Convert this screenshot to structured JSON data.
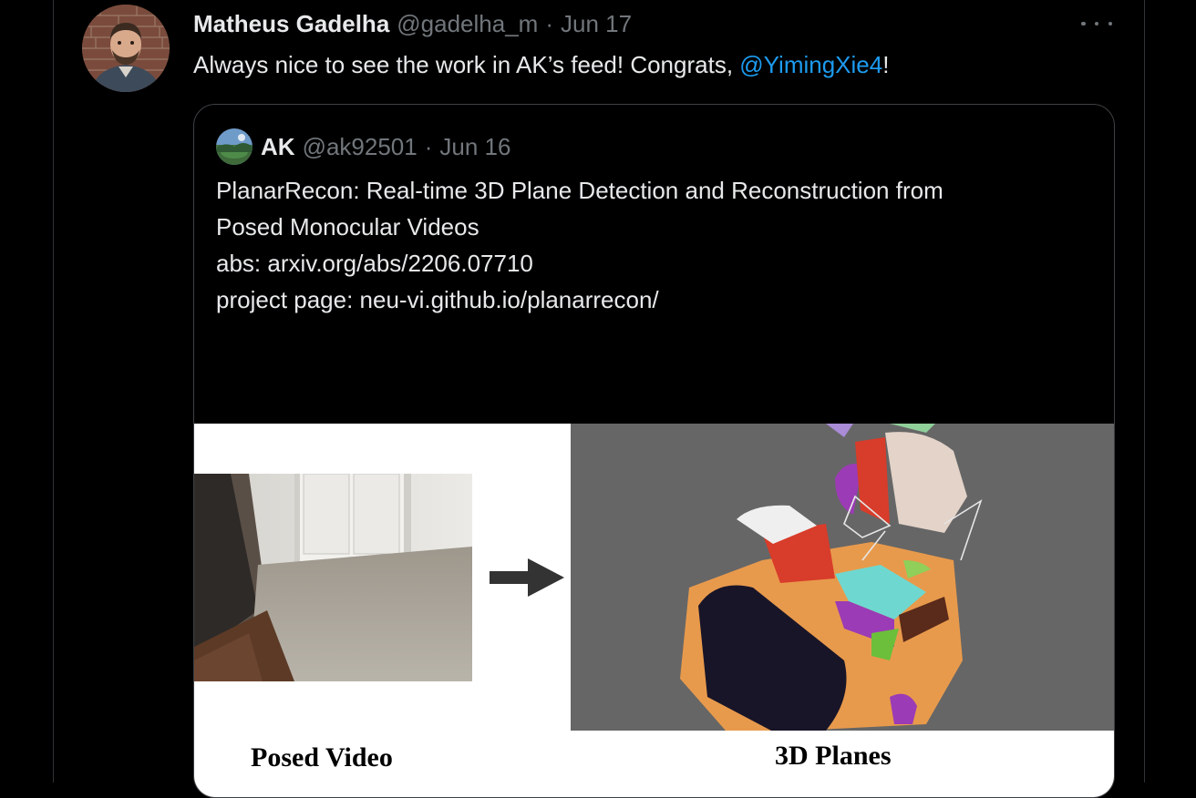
{
  "tweet": {
    "author_name": "Matheus Gadelha",
    "author_handle": "@gadelha_m",
    "separator": "·",
    "date": "Jun 17",
    "text_before": "Always nice to see the work in AK’s feed! Congrats, ",
    "mention": "@YimingXie4",
    "text_after": "!",
    "more_icon": "more-horizontal-icon"
  },
  "quoted_tweet": {
    "author_name": "AK",
    "author_handle": "@ak92501",
    "separator": "·",
    "date": "Jun 16",
    "lines": [
      "PlanarRecon: Real-time 3D Plane Detection and Reconstruction from",
      "Posed Monocular Videos",
      "abs: arxiv.org/abs/2206.07710",
      "project page: neu-vi.github.io/planarrecon/"
    ],
    "media": {
      "left_label": "Posed Video",
      "right_label": "3D Planes",
      "arrow_icon": "right-arrow-icon"
    }
  },
  "colors": {
    "background": "#000000",
    "primary_text": "#e7e9ea",
    "secondary_text": "#71767b",
    "link": "#1d9bf0",
    "border": "#3e4144"
  }
}
